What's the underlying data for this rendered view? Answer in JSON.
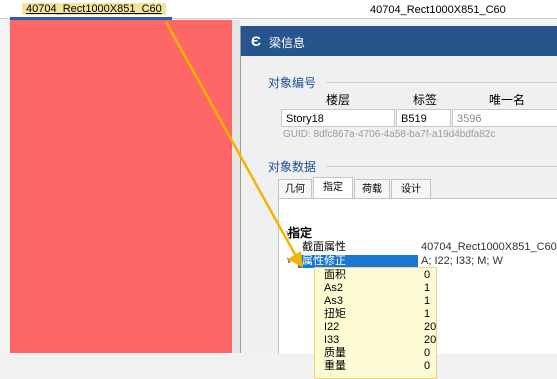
{
  "canvas": {
    "left_label": "40704_Rect1000X851_C60",
    "right_label": "40704_Rect1000X851_C60"
  },
  "dialog": {
    "title_icon": "Є",
    "title": "梁信息",
    "object_id_group": "对象编号",
    "columns": {
      "floor": "楼层",
      "tag": "标签",
      "unique": "唯一名"
    },
    "values": {
      "floor": "Story18",
      "tag": "B519",
      "unique": "3596"
    },
    "guid": "GUID: 8dfc867a-4706-4a58-ba7f-a19d4bdfa82c",
    "object_data_group": "对象数据",
    "tabs": [
      "几何",
      "指定",
      "荷载",
      "设计"
    ],
    "active_tab": "指定",
    "assign_section": "指定",
    "rows": [
      {
        "name": "截面属性",
        "value": "40704_Rect1000X851_C60"
      },
      {
        "name": "属性修正",
        "value": "A; I22; I33; M; W"
      }
    ],
    "modifiers": [
      {
        "name": "面积",
        "value": "0"
      },
      {
        "name": "As2",
        "value": "1"
      },
      {
        "name": "As3",
        "value": "1"
      },
      {
        "name": "扭矩",
        "value": "1"
      },
      {
        "name": "I22",
        "value": "20"
      },
      {
        "name": "I33",
        "value": "20"
      },
      {
        "name": "质量",
        "value": "0"
      },
      {
        "name": "重量",
        "value": "0"
      }
    ]
  },
  "colors": {
    "beam": "#ff6666",
    "titlebar": "#26548c",
    "highlight": "#1976d2",
    "arrow": "#f2b400",
    "annotation_box": "#fdfbd4"
  }
}
